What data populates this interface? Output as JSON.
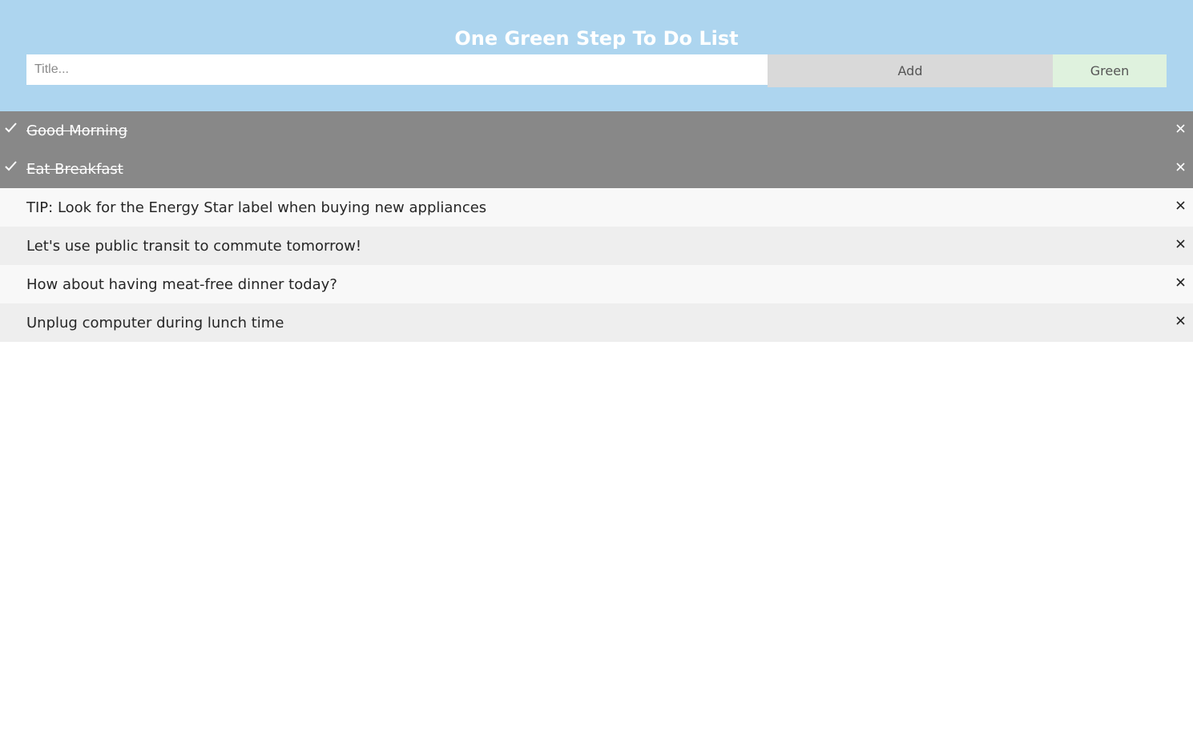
{
  "header": {
    "title": "One Green Step To Do List",
    "background": "#add5ef"
  },
  "form": {
    "placeholder": "Title...",
    "value": "",
    "add_label": "Add",
    "green_label": "Green"
  },
  "colors": {
    "checked_bg": "#888888",
    "odd_bg": "#f8f8f8",
    "even_bg": "#eeeeee",
    "green_button_bg": "#dff2de",
    "add_button_bg": "#d9d9d9"
  },
  "todos": [
    {
      "text": "Good Morning",
      "checked": true,
      "close_icon": "close-icon",
      "check_icon": "check-icon"
    },
    {
      "text": "Eat Breakfast",
      "checked": true,
      "close_icon": "close-icon",
      "check_icon": "check-icon"
    },
    {
      "text": "TIP: Look for the Energy Star label when buying new appliances",
      "checked": false,
      "close_icon": "close-icon"
    },
    {
      "text": "Let's use public transit to commute tomorrow!",
      "checked": false,
      "close_icon": "close-icon"
    },
    {
      "text": "How about having meat-free dinner today?",
      "checked": false,
      "close_icon": "close-icon"
    },
    {
      "text": "Unplug computer during lunch time",
      "checked": false,
      "close_icon": "close-icon"
    }
  ]
}
